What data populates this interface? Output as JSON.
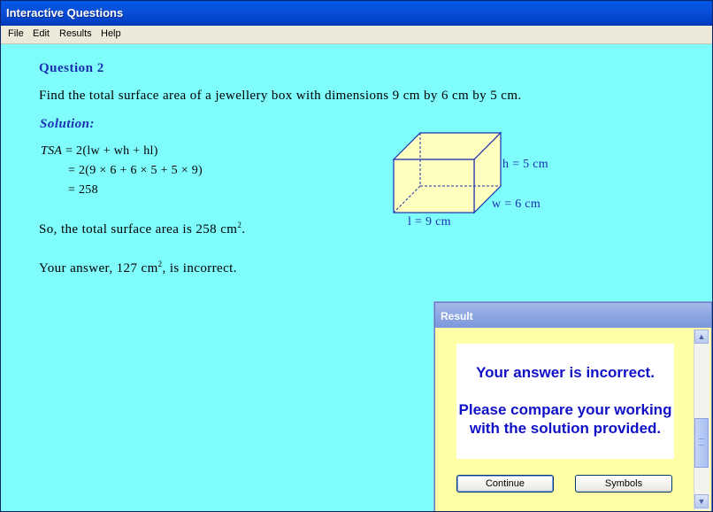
{
  "window": {
    "title": "Interactive Questions"
  },
  "menu": [
    "File",
    "Edit",
    "Results",
    "Help"
  ],
  "question": {
    "title": "Question 2",
    "text": "Find the total surface area of a jewellery box with dimensions 9 cm by 6 cm by 5 cm."
  },
  "solution": {
    "title": "Solution:",
    "eq1_lhs": "TSA",
    "eq1_rhs": "= 2(lw + wh + hl)",
    "eq2": "= 2(9 × 6 + 6 × 5 + 5 × 9)",
    "eq3": "= 258",
    "conclusion_prefix": "So, the total surface area is 258 cm",
    "conclusion_sup": "2",
    "conclusion_suffix": "."
  },
  "feedback": {
    "prefix": "Your answer, 127 cm",
    "sup": "2",
    "suffix": ", is incorrect."
  },
  "diagram": {
    "h_label": "h = 5 cm",
    "w_label": "w = 6 cm",
    "l_label": "l = 9 cm",
    "fill_color": "#ffffc0",
    "edge_color": "#1a2fb0"
  },
  "dialog": {
    "title": "Result",
    "line1": "Your answer is incorrect.",
    "line2": "Please compare your working with the solution provided.",
    "continue_label": "Continue",
    "symbols_label": "Symbols"
  }
}
